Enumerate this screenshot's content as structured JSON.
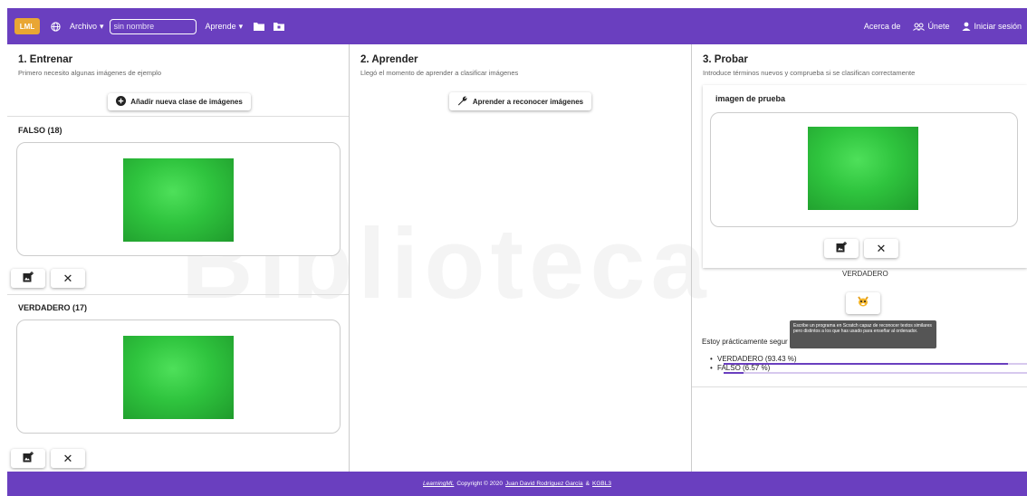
{
  "header": {
    "logo": "LML",
    "file_menu": "Archivo",
    "name_placeholder": "sin nombre",
    "learn_menu": "Aprende",
    "about": "Acerca de",
    "join": "Únete",
    "login": "Iniciar sesión"
  },
  "train": {
    "title": "1. Entrenar",
    "subtitle": "Primero necesito algunas imágenes de ejemplo",
    "add_class_button": "Añadir nueva clase de imágenes",
    "classes": [
      {
        "name": "FALSO (18)"
      },
      {
        "name": "VERDADERO (17)"
      }
    ]
  },
  "learn": {
    "title": "2. Aprender",
    "subtitle": "Llegó el momento de aprender a clasificar imágenes",
    "learn_button": "Aprender a reconocer imágenes"
  },
  "test": {
    "title": "3. Probar",
    "subtitle": "Introduce términos nuevos y comprueba si se clasifican correctamente",
    "card_title": "imagen de prueba",
    "result_label": "VERDADERO",
    "tooltip": "Escribe un programa en Scratch capaz de reconocer textos similares pero distintos a los que has usado para enseñar al ordenador.",
    "sure_text": "Estoy prácticamente segur",
    "results": [
      {
        "label": "VERDADERO (93.43 %)",
        "fraction": 0.9343
      },
      {
        "label": "FALSO (6.57 %)",
        "fraction": 0.0657
      }
    ]
  },
  "footer": {
    "brand": "LearningML",
    "copyright": "Copyright © 2020",
    "author": "Juan David Rodríguez García",
    "amp": "&",
    "org": "KGBL3"
  },
  "watermark": "Biblioteca",
  "colors": {
    "primary": "#6a3fbf",
    "logo": "#e9a633"
  }
}
